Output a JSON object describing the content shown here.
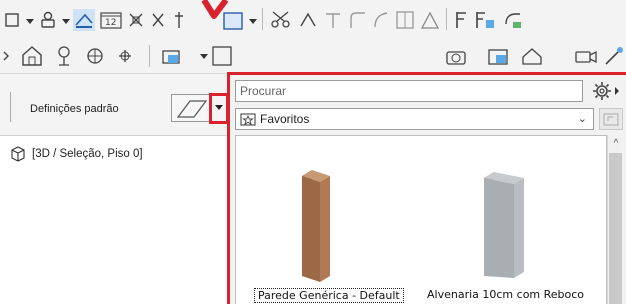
{
  "toolbar": {
    "default_settings_label": "Definições padrão"
  },
  "tree": {
    "view_item_label": "[3D / Seleção, Piso 0]"
  },
  "popup": {
    "search_placeholder": "Procurar",
    "folder_selected": "Favoritos",
    "items": [
      {
        "label": "Parede Genérica - Default"
      },
      {
        "label": "Alvenaria 10cm com Reboco"
      }
    ]
  },
  "colors": {
    "highlight_red": "#d9222e",
    "wood_wall": "#b07a55",
    "masonry_wall": "#a9aeb3",
    "brick_edge": "#b5563b"
  },
  "icons": [
    "wall-preview-icon",
    "gear-icon",
    "star-folder-icon",
    "folder-up-icon",
    "view-3d-icon"
  ]
}
